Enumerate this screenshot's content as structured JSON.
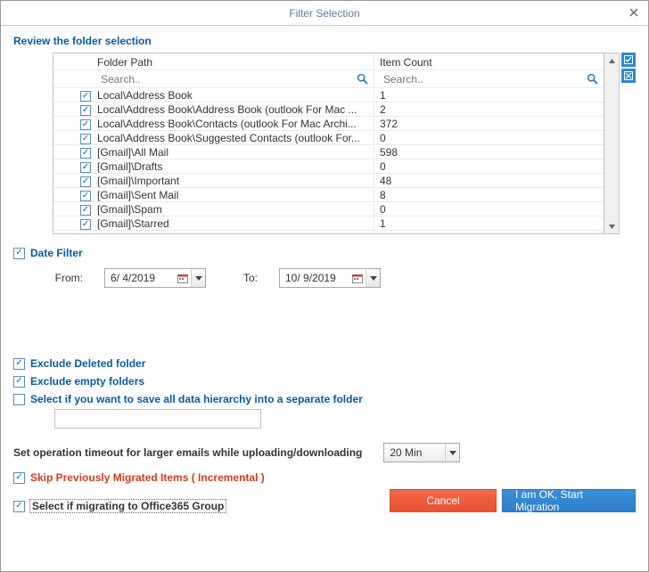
{
  "window": {
    "title": "Filter Selection"
  },
  "section_title": "Review the folder selection",
  "grid": {
    "headers": {
      "path": "Folder Path",
      "count": "Item Count"
    },
    "search_placeholder": "Search..",
    "rows": [
      {
        "checked": true,
        "path": "Local\\Address Book",
        "count": "1"
      },
      {
        "checked": true,
        "path": "Local\\Address Book\\Address Book (outlook For Mac ...",
        "count": "2"
      },
      {
        "checked": true,
        "path": "Local\\Address Book\\Contacts (outlook For Mac Archi...",
        "count": "372"
      },
      {
        "checked": true,
        "path": "Local\\Address Book\\Suggested Contacts (outlook For...",
        "count": "0"
      },
      {
        "checked": true,
        "path": "[Gmail]\\All Mail",
        "count": "598"
      },
      {
        "checked": true,
        "path": "[Gmail]\\Drafts",
        "count": "0"
      },
      {
        "checked": true,
        "path": "[Gmail]\\Important",
        "count": "48"
      },
      {
        "checked": true,
        "path": "[Gmail]\\Sent Mail",
        "count": "8"
      },
      {
        "checked": true,
        "path": "[Gmail]\\Spam",
        "count": "0"
      },
      {
        "checked": true,
        "path": "[Gmail]\\Starred",
        "count": "1"
      }
    ]
  },
  "date_filter": {
    "label": "Date Filter",
    "checked": true,
    "from_label": "From:",
    "from_value": "6/ 4/2019",
    "to_label": "To:",
    "to_value": "10/ 9/2019"
  },
  "options": {
    "exclude_deleted": {
      "label": "Exclude Deleted folder",
      "checked": true
    },
    "exclude_empty": {
      "label": "Exclude empty folders",
      "checked": true
    },
    "save_hierarchy": {
      "label": "Select if you want to save all data hierarchy into a separate folder",
      "checked": false,
      "value": ""
    }
  },
  "timeout": {
    "label": "Set operation timeout for larger emails while uploading/downloading",
    "value": "20 Min"
  },
  "skip_prev": {
    "label": "Skip Previously Migrated Items ( Incremental )",
    "checked": true
  },
  "o365": {
    "label": "Select if migrating to Office365 Group",
    "checked": true
  },
  "buttons": {
    "cancel": "Cancel",
    "ok": "I am OK, Start Migration"
  }
}
